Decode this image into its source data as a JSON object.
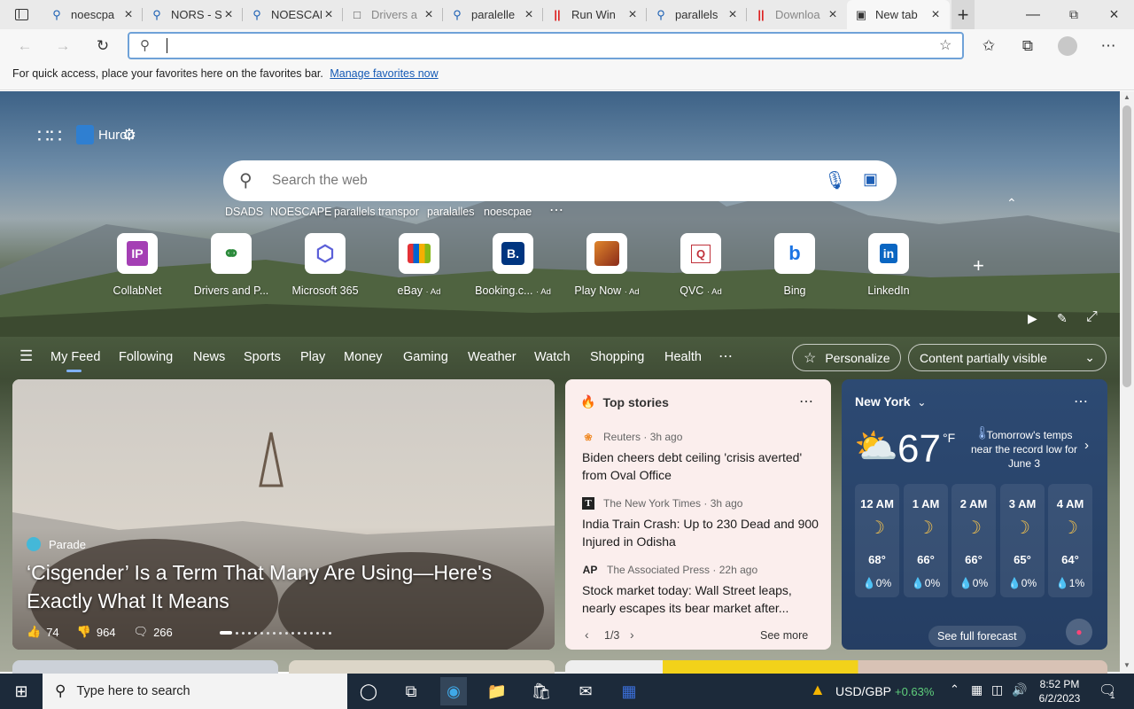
{
  "tabs": [
    {
      "label": "noescpa",
      "icon": "search-icon"
    },
    {
      "label": "NORS - S",
      "icon": "search-icon"
    },
    {
      "label": "NOESCAP",
      "icon": "search-icon"
    },
    {
      "label": "Drivers a",
      "icon": "page-icon"
    },
    {
      "label": "paralelle",
      "icon": "search-icon"
    },
    {
      "label": "Run Win",
      "icon": "parallels-icon"
    },
    {
      "label": "parallels",
      "icon": "search-icon"
    },
    {
      "label": "Downloa",
      "icon": "parallels-icon"
    },
    {
      "label": "New tab",
      "icon": "newtab-icon",
      "active": true
    }
  ],
  "favorites_bar": {
    "message": "For quick access, place your favorites here on the favorites bar.",
    "link": "Manage favorites now"
  },
  "hero": {
    "brand": "Huron",
    "search_placeholder": "Search the web",
    "recent_searches": [
      "DSADS",
      "NOESCAPE",
      "parallels transpor",
      "paralalles",
      "noescpae"
    ],
    "quick_links": [
      {
        "name": "CollabNet",
        "ad": "",
        "icon": "IP"
      },
      {
        "name": "Drivers and P...",
        "ad": "",
        "icon": "drivers-icon"
      },
      {
        "name": "Microsoft 365",
        "ad": "",
        "icon": "m365-icon"
      },
      {
        "name": "eBay",
        "ad": "· Ad",
        "icon": "ebay-icon"
      },
      {
        "name": "Booking.c...",
        "ad": "· Ad",
        "icon": "B."
      },
      {
        "name": "Play Now",
        "ad": "· Ad",
        "icon": "game-icon"
      },
      {
        "name": "QVC",
        "ad": "· Ad",
        "icon": "Q"
      },
      {
        "name": "Bing",
        "ad": "",
        "icon": "b"
      },
      {
        "name": "LinkedIn",
        "ad": "",
        "icon": "in"
      }
    ]
  },
  "feed_nav": {
    "items": [
      "My Feed",
      "Following",
      "News",
      "Sports",
      "Play",
      "Money",
      "Gaming",
      "Weather",
      "Watch",
      "Shopping",
      "Health"
    ],
    "active": "My Feed",
    "personalize": "Personalize",
    "visibility": "Content partially visible"
  },
  "big_card": {
    "source": "Parade",
    "headline": "‘Cisgender’ Is a Term That Many Are Using—Here's Exactly What It Means",
    "likes": "74",
    "dislikes": "964",
    "comments": "266"
  },
  "top_stories": {
    "title": "Top stories",
    "stories": [
      {
        "source": "Reuters",
        "time": "· 3h ago",
        "headline": "Biden cheers debt ceiling 'crisis averted' from Oval Office"
      },
      {
        "source": "The New York Times",
        "time": "· 3h ago",
        "headline": "India Train Crash: Up to 230 Dead and 900 Injured in Odisha"
      },
      {
        "source": "The Associated Press",
        "time": "· 22h ago",
        "headline": "Stock market today: Wall Street leaps, nearly escapes its bear market after..."
      }
    ],
    "pager": "1/3",
    "see_more": "See more"
  },
  "weather": {
    "city": "New York",
    "temp": "67",
    "unit": "°F",
    "alert": "Tomorrow's temps near the record low for June 3",
    "hours": [
      {
        "time": "12 AM",
        "temp": "68°",
        "precip": "0%"
      },
      {
        "time": "1 AM",
        "temp": "66°",
        "precip": "0%"
      },
      {
        "time": "2 AM",
        "temp": "66°",
        "precip": "0%"
      },
      {
        "time": "3 AM",
        "temp": "65°",
        "precip": "0%"
      },
      {
        "time": "4 AM",
        "temp": "64°",
        "precip": "1%"
      }
    ],
    "forecast_link": "See full forecast"
  },
  "taskbar": {
    "search_placeholder": "Type here to search",
    "ticker": "USD/GBP",
    "ticker_change": "+0.63%",
    "time": "8:52 PM",
    "date": "6/2/2023",
    "notifications": "1"
  }
}
